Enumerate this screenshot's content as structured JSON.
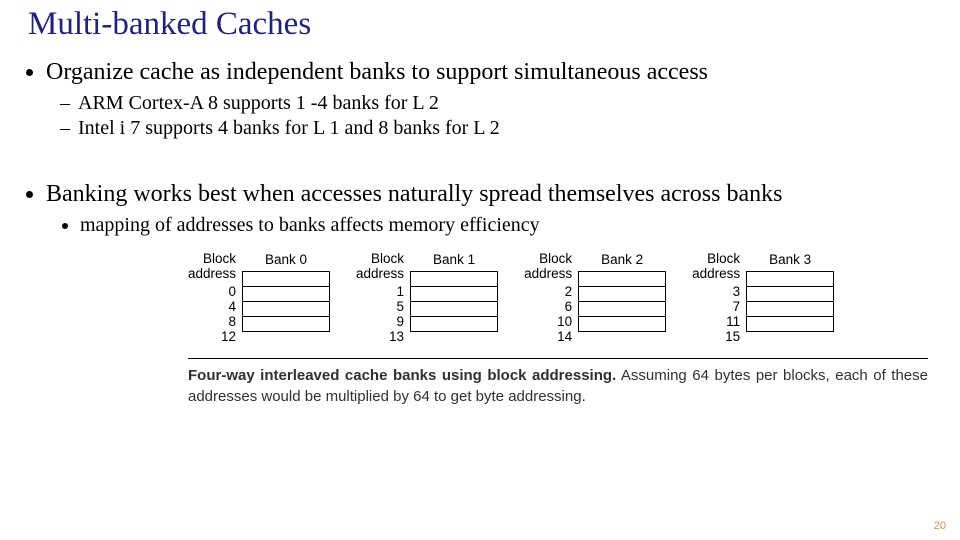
{
  "title": "Multi-banked Caches",
  "bullets": {
    "b1": "Organize cache as independent banks to support simultaneous access",
    "b1a": "ARM Cortex-A 8 supports 1 -4 banks for L 2",
    "b1b": "Intel i 7 supports 4 banks for L 1 and 8 banks for L 2",
    "b2": "Banking works best when accesses naturally spread themselves across banks",
    "b2a": "mapping of addresses to banks affects memory efficiency"
  },
  "diagram": {
    "addr_header": "Block\naddress",
    "banks": [
      {
        "label": "Bank 0",
        "addrs": [
          "0",
          "4",
          "8",
          "12"
        ]
      },
      {
        "label": "Bank 1",
        "addrs": [
          "1",
          "5",
          "9",
          "13"
        ]
      },
      {
        "label": "Bank 2",
        "addrs": [
          "2",
          "6",
          "10",
          "14"
        ]
      },
      {
        "label": "Bank 3",
        "addrs": [
          "3",
          "7",
          "11",
          "15"
        ]
      }
    ]
  },
  "caption": {
    "bold": "Four-way interleaved cache banks using block addressing.",
    "rest": " Assuming 64 bytes per blocks, each of these addresses would be multiplied by 64 to get byte addressing."
  },
  "page_number": "20"
}
